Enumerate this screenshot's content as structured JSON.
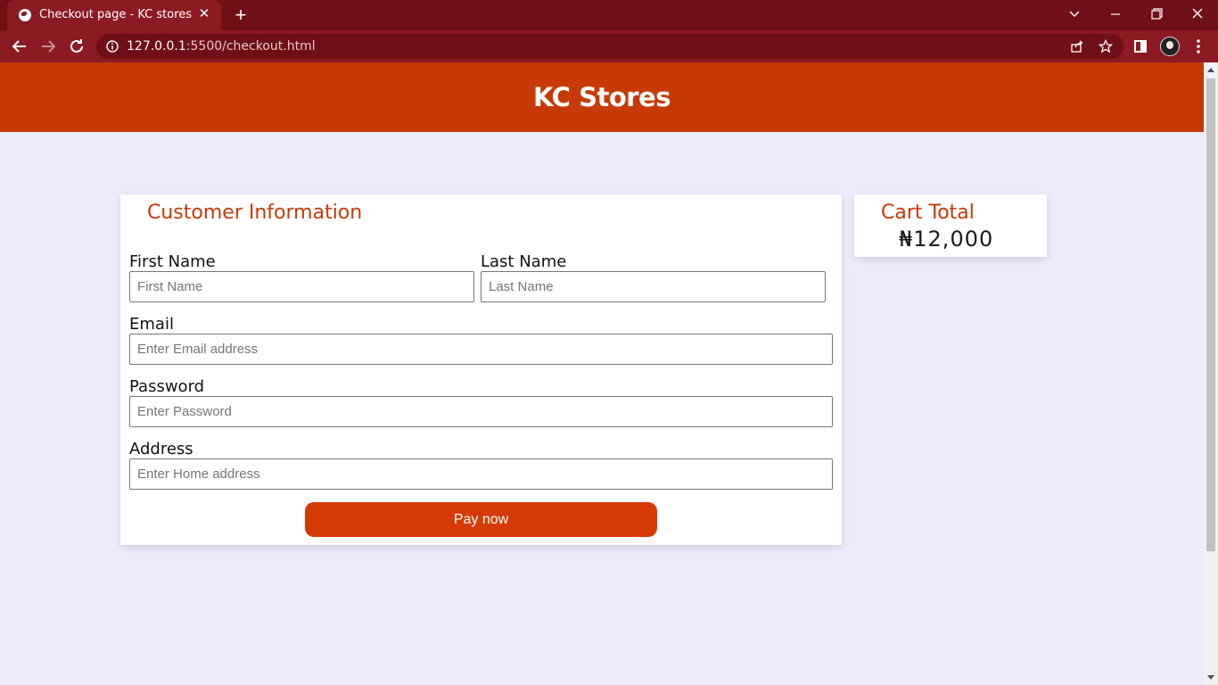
{
  "browser": {
    "tab_title": "Checkout page - KC stores",
    "url_host": "127.0.0.1",
    "url_rest": ":5500/checkout.html",
    "theme_color": "#8b1a22"
  },
  "site": {
    "title": "KC Stores",
    "brand_color": "#c73a08"
  },
  "form": {
    "section_title": "Customer Information",
    "first_name": {
      "label": "First Name",
      "placeholder": "First Name",
      "value": ""
    },
    "last_name": {
      "label": "Last Name",
      "placeholder": "Last Name",
      "value": ""
    },
    "email": {
      "label": "Email",
      "placeholder": "Enter Email address",
      "value": ""
    },
    "password": {
      "label": "Password",
      "placeholder": "Enter Password",
      "value": ""
    },
    "address": {
      "label": "Address",
      "placeholder": "Enter Home address",
      "value": ""
    },
    "pay_button": "Pay now"
  },
  "cart": {
    "title": "Cart Total",
    "amount": "₦12,000"
  }
}
